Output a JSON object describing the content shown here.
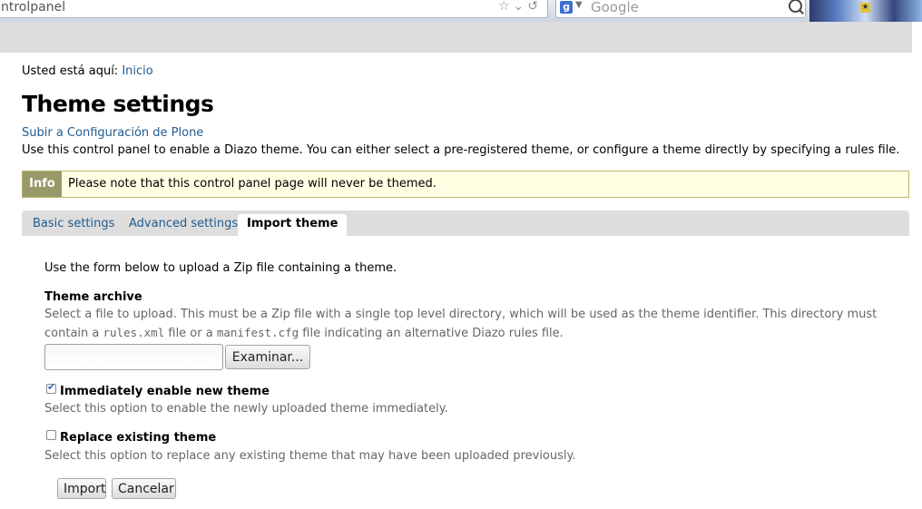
{
  "browser": {
    "url_partial": "ntrolpanel",
    "search_placeholder": "Google",
    "search_engine_letter": "g"
  },
  "breadcrumbs": {
    "prefix": "Usted está aquí:",
    "home": "Inicio"
  },
  "page_title": "Theme settings",
  "up_link": "Subir a Configuración de Plone",
  "description": "Use this control panel to enable a Diazo theme. You can either select a pre-registered theme, or configure a theme directly by specifying a rules file.",
  "info": {
    "tag": "Info",
    "message": "Please note that this control panel page will never be themed."
  },
  "tabs": [
    {
      "label": "Basic settings",
      "active": false
    },
    {
      "label": "Advanced settings",
      "active": false
    },
    {
      "label": "Import theme",
      "active": true
    }
  ],
  "form": {
    "lead": "Use the form below to upload a Zip file containing a theme.",
    "archive_label": "Theme archive",
    "archive_help_1": "Select a file to upload. This must be a Zip file with a single top level directory, which will be used as the theme identifier. This directory must contain a",
    "archive_help_code1": "rules.xml",
    "archive_help_2": "file or a",
    "archive_help_code2": "manifest.cfg",
    "archive_help_3": "file indicating an alternative Diazo rules file.",
    "file_value": "",
    "browse_label": "Examinar...",
    "enable_label": "Immediately enable new theme",
    "enable_checked": true,
    "enable_help": "Select this option to enable the newly uploaded theme immediately.",
    "replace_label": "Replace existing theme",
    "replace_checked": false,
    "replace_help": "Select this option to replace any existing theme that may have been uploaded previously.",
    "import_label": "Import",
    "cancel_label": "Cancelar"
  },
  "colors": {
    "link": "#205c90",
    "info_bg": "#ffffe3",
    "info_tag": "#989868",
    "tabbar": "#dddddd"
  }
}
